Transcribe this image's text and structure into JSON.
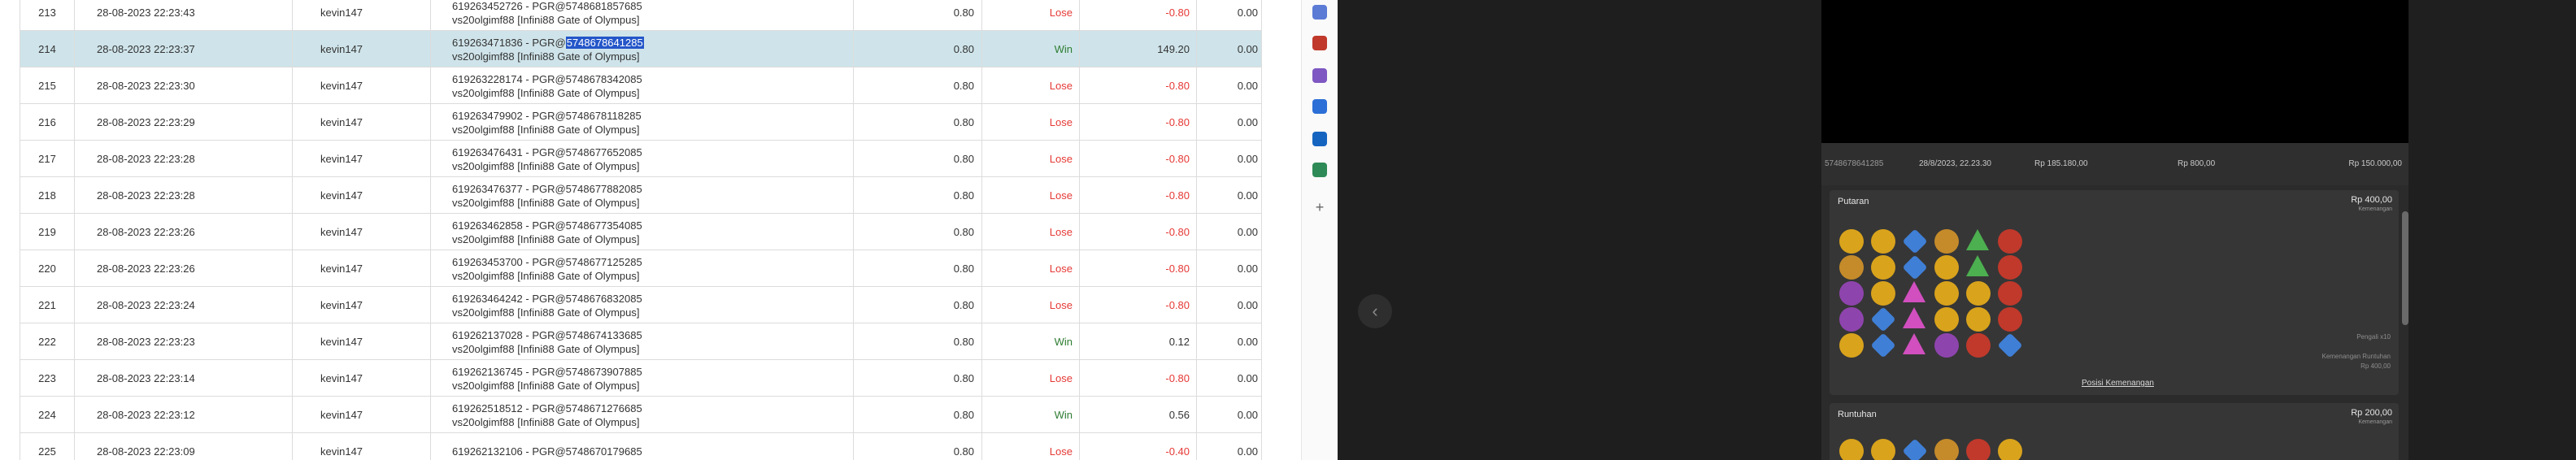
{
  "table": {
    "rows": [
      {
        "no": "213",
        "date": "28-08-2023 22:23:43",
        "user": "kevin147",
        "desc1": "619263452726 - PGR@5748681857685",
        "desc2": "vs20olgimf88 [Infini88 Gate of Olympus]",
        "bet": "0.80",
        "result": "Lose",
        "amount": "-0.80",
        "balance": "0.00"
      },
      {
        "no": "214",
        "date": "28-08-2023 22:23:37",
        "user": "kevin147",
        "desc1_pre": "619263471836 - PGR@",
        "desc1_hl": "5748678641285",
        "desc2": "vs20olgimf88 [Infini88 Gate of Olympus]",
        "bet": "0.80",
        "result": "Win",
        "amount": "149.20",
        "balance": "0.00"
      },
      {
        "no": "215",
        "date": "28-08-2023 22:23:30",
        "user": "kevin147",
        "desc1": "619263228174 - PGR@5748678342085",
        "desc2": "vs20olgimf88 [Infini88 Gate of Olympus]",
        "bet": "0.80",
        "result": "Lose",
        "amount": "-0.80",
        "balance": "0.00"
      },
      {
        "no": "216",
        "date": "28-08-2023 22:23:29",
        "user": "kevin147",
        "desc1": "619263479902 - PGR@5748678118285",
        "desc2": "vs20olgimf88 [Infini88 Gate of Olympus]",
        "bet": "0.80",
        "result": "Lose",
        "amount": "-0.80",
        "balance": "0.00"
      },
      {
        "no": "217",
        "date": "28-08-2023 22:23:28",
        "user": "kevin147",
        "desc1": "619263476431 - PGR@5748677652085",
        "desc2": "vs20olgimf88 [Infini88 Gate of Olympus]",
        "bet": "0.80",
        "result": "Lose",
        "amount": "-0.80",
        "balance": "0.00"
      },
      {
        "no": "218",
        "date": "28-08-2023 22:23:28",
        "user": "kevin147",
        "desc1": "619263476377 - PGR@5748677882085",
        "desc2": "vs20olgimf88 [Infini88 Gate of Olympus]",
        "bet": "0.80",
        "result": "Lose",
        "amount": "-0.80",
        "balance": "0.00"
      },
      {
        "no": "219",
        "date": "28-08-2023 22:23:26",
        "user": "kevin147",
        "desc1": "619263462858 - PGR@5748677354085",
        "desc2": "vs20olgimf88 [Infini88 Gate of Olympus]",
        "bet": "0.80",
        "result": "Lose",
        "amount": "-0.80",
        "balance": "0.00"
      },
      {
        "no": "220",
        "date": "28-08-2023 22:23:26",
        "user": "kevin147",
        "desc1": "619263453700 - PGR@5748677125285",
        "desc2": "vs20olgimf88 [Infini88 Gate of Olympus]",
        "bet": "0.80",
        "result": "Lose",
        "amount": "-0.80",
        "balance": "0.00"
      },
      {
        "no": "221",
        "date": "28-08-2023 22:23:24",
        "user": "kevin147",
        "desc1": "619263464242 - PGR@5748676832085",
        "desc2": "vs20olgimf88 [Infini88 Gate of Olympus]",
        "bet": "0.80",
        "result": "Lose",
        "amount": "-0.80",
        "balance": "0.00"
      },
      {
        "no": "222",
        "date": "28-08-2023 22:23:23",
        "user": "kevin147",
        "desc1": "619262137028 - PGR@5748674133685",
        "desc2": "vs20olgimf88 [Infini88 Gate of Olympus]",
        "bet": "0.80",
        "result": "Win",
        "amount": "0.12",
        "balance": "0.00"
      },
      {
        "no": "223",
        "date": "28-08-2023 22:23:14",
        "user": "kevin147",
        "desc1": "619262136745 - PGR@5748673907885",
        "desc2": "vs20olgimf88 [Infini88 Gate of Olympus]",
        "bet": "0.80",
        "result": "Lose",
        "amount": "-0.80",
        "balance": "0.00"
      },
      {
        "no": "224",
        "date": "28-08-2023 22:23:12",
        "user": "kevin147",
        "desc1": "619262518512 - PGR@5748671276685",
        "desc2": "vs20olgimf88 [Infini88 Gate of Olympus]",
        "bet": "0.80",
        "result": "Win",
        "amount": "0.56",
        "balance": "0.00"
      },
      {
        "no": "225",
        "date": "28-08-2023 22:23:09",
        "user": "kevin147",
        "desc1": "619262132106 - PGR@5748670179685",
        "desc2": "",
        "bet": "0.80",
        "result": "Lose",
        "amount": "-0.40",
        "balance": "0.00"
      }
    ]
  },
  "side": {
    "icons": [
      "tag-icon",
      "briefcase-icon",
      "people-icon",
      "gear-icon",
      "outlook-icon",
      "cart-icon",
      "add-icon"
    ],
    "colors": [
      "#5b7bd5",
      "#c0392b",
      "#7e57c2",
      "#2c6fd6",
      "#1565c0",
      "#2e8b57",
      "#666666"
    ]
  },
  "game": {
    "back_icon": "‹",
    "info": {
      "round_id": "5748678641285",
      "datetime": "28/8/2023, 22.23.30",
      "balance": "Rp 185.180,00",
      "bet": "Rp 800,00",
      "win": "Rp 150.000,00"
    },
    "spin": {
      "title": "Putaran",
      "amount": "Rp 400,00",
      "sublabel": "Kemenangan",
      "side_label_1": "Pengali x10",
      "side_label_2": "Kemenangan Runtuhan",
      "side_label_3": "Rp 400,00",
      "positions_link": "Posisi Kemenangan"
    },
    "tumble": {
      "title": "Runtuhan",
      "amount": "Rp 200,00",
      "sublabel": "Kemenangan"
    },
    "gem_colors": {
      "gold": "#d9a31c",
      "blue": "#3f7fd6",
      "crown": "#c58b2a",
      "green": "#4caf50",
      "red": "#c0392b",
      "purple": "#8e44ad",
      "pink": "#d14fbf"
    }
  }
}
